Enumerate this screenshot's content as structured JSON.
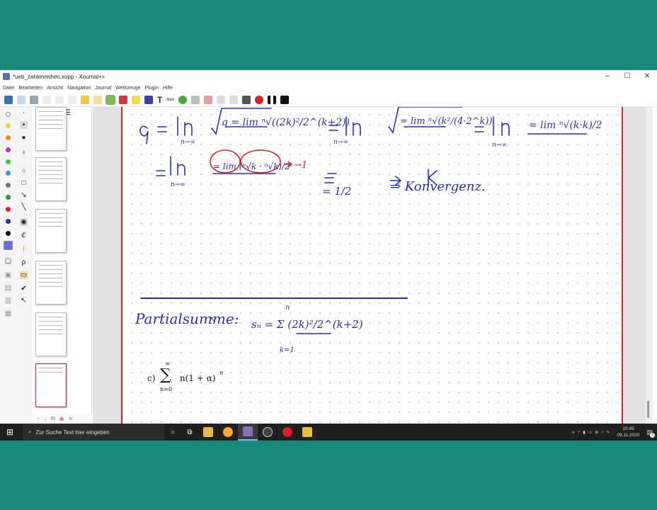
{
  "window": {
    "title": "*ueb_zahlenreihen.xopp - Xournal++",
    "min": "–",
    "max": "☐",
    "close": "✕"
  },
  "menu": [
    "Datei",
    "Bearbeiten",
    "Ansicht",
    "Navigation",
    "Journal",
    "Werkzeuge",
    "Plugin",
    "Hilfe"
  ],
  "toolbar": {
    "text_tool": "T",
    "math_tool": "Math"
  },
  "ink": {
    "line1a": "q = lim ⁿ√((2k)²/2^(k+2))",
    "line1a_sub": "n→∞",
    "line1b": "= lim ⁿ√(k²/(4·2^k))",
    "line1b_sub": "n→∞",
    "line1c": "= lim ⁿ√(k·k)/2",
    "line1c_sub": "n→∞",
    "line2a": "= lim (ⁿ√k · ⁿ√k)/2",
    "line2a_sub": "n→∞",
    "arrow_note": "→1",
    "line2b": "= 1/2",
    "line2c": "⇒ Konvergenz.",
    "partial_label": "Partialsumme:",
    "partial_formula": "sₙ = Σ (2k)²/2^(k+2)",
    "partial_lower": "k=1",
    "partial_upper": "n"
  },
  "formula": {
    "label": "c)",
    "upper": "∞",
    "lower": "n=0",
    "body": "n(1 + α)"
  },
  "taskbar": {
    "search_placeholder": "Zur Suche Text hier eingeben",
    "time": "20:45",
    "date": "09.11.2020",
    "notif_count": "2"
  },
  "colors": {
    "ink_blue": "#2b2fb0",
    "ink_red": "#d81f2a",
    "page_border": "#c22b33",
    "desktop": "#178a78"
  }
}
